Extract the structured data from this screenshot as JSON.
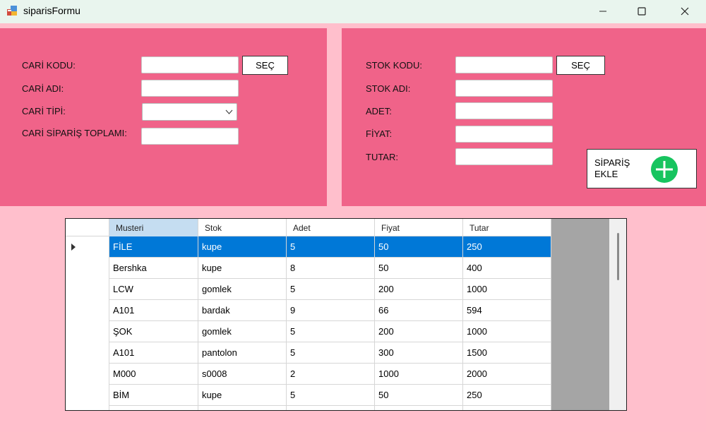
{
  "window": {
    "title": "siparisFormu",
    "minimize_icon": "minimize-icon",
    "maximize_icon": "maximize-icon",
    "close_icon": "close-icon"
  },
  "left_panel": {
    "cari_kodu_label": "CARİ KODU:",
    "cari_kodu_value": "",
    "sec_label": "SEÇ",
    "cari_adi_label": "CARİ ADI:",
    "cari_adi_value": "",
    "cari_tipi_label": "CARİ TİPİ:",
    "cari_tipi_value": "",
    "cari_siparis_toplami_label": "CARİ SİPARİŞ TOPLAMI:",
    "cari_siparis_toplami_value": ""
  },
  "right_panel": {
    "stok_kodu_label": "STOK KODU:",
    "stok_kodu_value": "",
    "sec_label": "SEÇ",
    "stok_adi_label": "STOK ADI:",
    "stok_adi_value": "",
    "adet_label": "ADET:",
    "adet_value": "",
    "fiyat_label": "FİYAT:",
    "fiyat_value": "",
    "tutar_label": "TUTAR:",
    "tutar_value": "",
    "siparis_ekle_label": "SİPARİŞ\nEKLE",
    "plus_icon": "plus-circle-icon"
  },
  "grid": {
    "columns": [
      "Musteri",
      "Stok",
      "Adet",
      "Fiyat",
      "Tutar"
    ],
    "rows": [
      [
        "FİLE",
        "kupe",
        "5",
        "50",
        "250"
      ],
      [
        "Bershka",
        "kupe",
        "8",
        "50",
        "400"
      ],
      [
        "LCW",
        "gomlek",
        "5",
        "200",
        "1000"
      ],
      [
        "A101",
        "bardak",
        "9",
        "66",
        "594"
      ],
      [
        "ŞOK",
        "gomlek",
        "5",
        "200",
        "1000"
      ],
      [
        "A101",
        "pantolon",
        "5",
        "300",
        "1500"
      ],
      [
        "M000",
        "s0008",
        "2",
        "1000",
        "2000"
      ],
      [
        "BİM",
        "kupe",
        "5",
        "50",
        "250"
      ]
    ],
    "selected_row": 0,
    "colors": {
      "selection": "#0078d7",
      "header_selected": "#c5ddf1",
      "panel": "#f06389",
      "background": "#ffbfcc"
    }
  }
}
